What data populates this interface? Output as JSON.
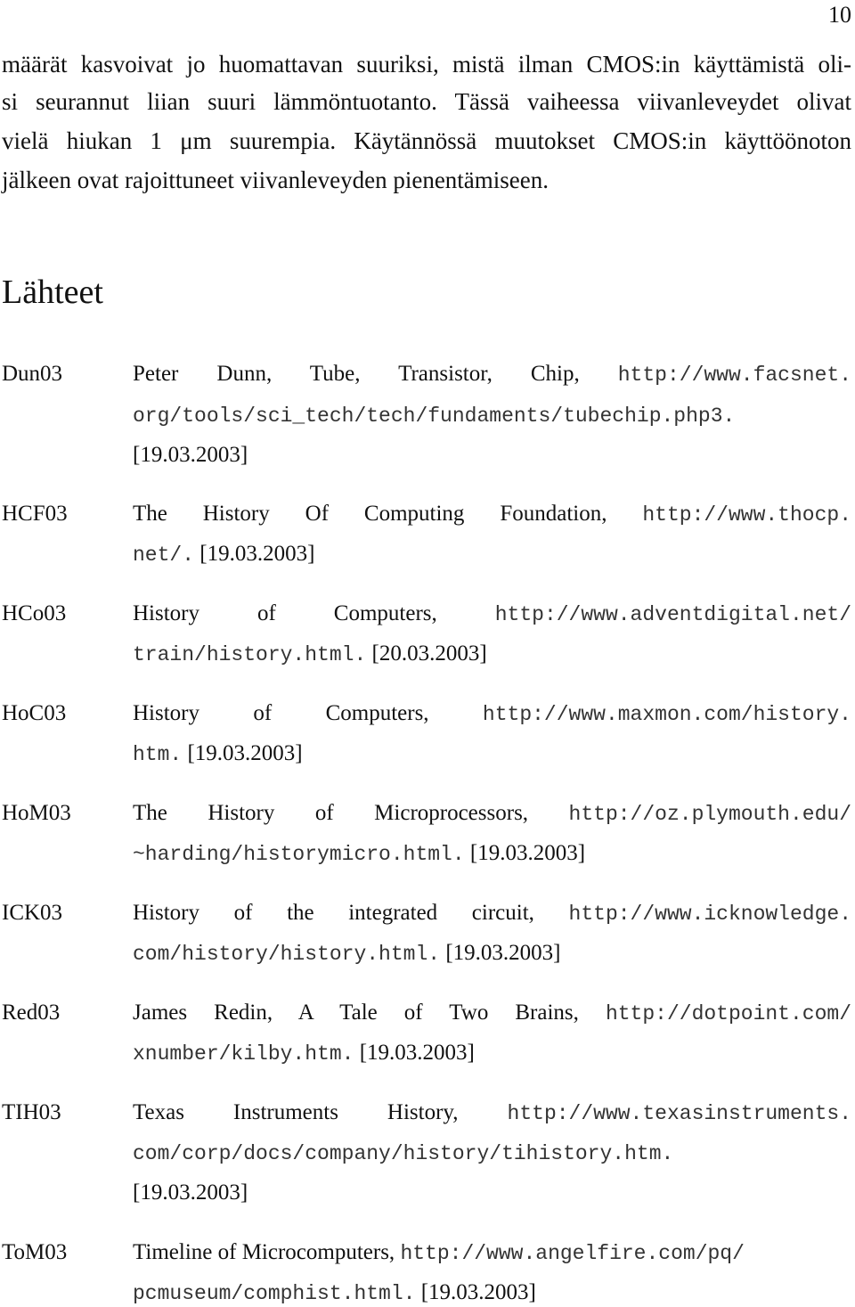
{
  "page_number": "10",
  "paragraph": {
    "lines": [
      "määrät kasvoivat jo huomattavan suuriksi, mistä ilman CMOS:in käyttämistä oli-",
      "si seurannut liian suuri lämmöntuotanto. Tässä vaiheessa viivanleveydet olivat",
      "vielä hiukan 1 μm suurempia. Käytännössä muutokset CMOS:in käyttöönoton",
      "jälkeen ovat rajoittuneet viivanleveyden pienentämiseen."
    ]
  },
  "heading": "Lähteet",
  "references": [
    {
      "key": "Dun03",
      "title": "Peter Dunn, Tube, Transistor, Chip, ",
      "url_lines": [
        "http://www.facsnet.",
        "org/tools/sci_tech/tech/fundaments/tubechip.php3."
      ],
      "date": "[19.03.2003]"
    },
    {
      "key": "HCF03",
      "title": "The History Of Computing Foundation, ",
      "url_lines": [
        "http://www.thocp.",
        "net/."
      ],
      "date": "[19.03.2003]"
    },
    {
      "key": "HCo03",
      "title": "History of Computers, ",
      "url_lines": [
        "http://www.adventdigital.net/",
        "train/history.html."
      ],
      "date": "[20.03.2003]"
    },
    {
      "key": "HoC03",
      "title": "History of Computers, ",
      "url_lines": [
        "http://www.maxmon.com/history.",
        "htm."
      ],
      "date": "[19.03.2003]"
    },
    {
      "key": "HoM03",
      "title": "The History of Microprocessors, ",
      "url_lines": [
        "http://oz.plymouth.edu/",
        "~harding/historymicro.html."
      ],
      "date": "[19.03.2003]"
    },
    {
      "key": "ICK03",
      "title": "History of the integrated circuit, ",
      "url_lines": [
        "http://www.icknowledge.",
        "com/history/history.html."
      ],
      "date": "[19.03.2003]"
    },
    {
      "key": "Red03",
      "title": "James Redin, A Tale of Two Brains, ",
      "url_lines": [
        "http://dotpoint.com/",
        "xnumber/kilby.htm."
      ],
      "date": "[19.03.2003]"
    },
    {
      "key": "TIH03",
      "title": "Texas Instruments History, ",
      "url_lines": [
        "http://www.texasinstruments.",
        "com/corp/docs/company/history/tihistory.htm."
      ],
      "date": "[19.03.2003]"
    },
    {
      "key": "ToM03",
      "title": "Timeline of Microcomputers, ",
      "url_lines": [
        "http://www.angelfire.com/pq/",
        "pcmuseum/comphist.html."
      ],
      "date": "[19.03.2003]"
    }
  ]
}
